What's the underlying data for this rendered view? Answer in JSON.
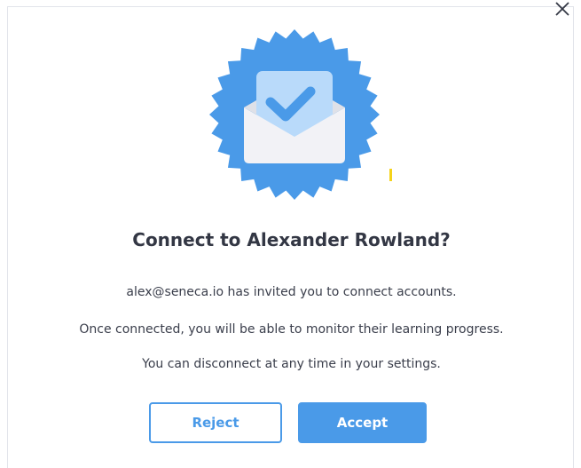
{
  "icons": {
    "close": "close-icon",
    "badge": "envelope-check-badge-icon"
  },
  "colors": {
    "accent": "#4a9ae8",
    "badge": "#4a9ae8",
    "envelope": "#f2f2f6",
    "check_card": "#b9dafa",
    "text": "#333744",
    "marker": "#f5d31a"
  },
  "dialog": {
    "title": "Connect to Alexander Rowland?",
    "lines": [
      "alex@seneca.io has invited you to connect accounts.",
      "Once connected, you will be able to monitor their learning progress.",
      "You can disconnect at any time in your settings."
    ],
    "reject_label": "Reject",
    "accept_label": "Accept"
  }
}
